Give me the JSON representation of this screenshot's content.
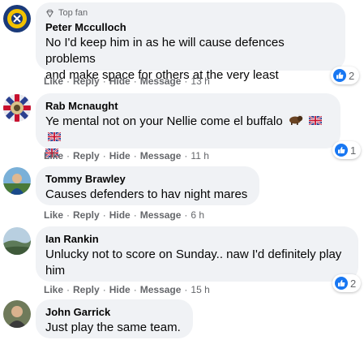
{
  "comments": [
    {
      "badge": "Top fan",
      "author": "Peter Mcculloch",
      "text_line1": "No I'd keep him in as he will cause defences problems",
      "text_line2": "and make space for others at the very least",
      "actions": {
        "like": "Like",
        "reply": "Reply",
        "hide": "Hide",
        "message": "Message",
        "time": "13 h"
      },
      "reaction_count": "2"
    },
    {
      "author": "Rab Mcnaught",
      "text": "Ye mental not on your Nellie come el buffalo",
      "emojis": [
        "bison-emoji",
        "uk-flag-emoji",
        "uk-flag-emoji",
        "uk-flag-emoji"
      ],
      "actions": {
        "like": "Like",
        "reply": "Reply",
        "hide": "Hide",
        "message": "Message",
        "time": "11 h"
      },
      "reaction_count": "1"
    },
    {
      "author": "Tommy Brawley",
      "text": "Causes defenders to hav night mares",
      "actions": {
        "like": "Like",
        "reply": "Reply",
        "hide": "Hide",
        "message": "Message",
        "time": "6 h"
      }
    },
    {
      "author": "Ian Rankin",
      "text_line1": "Unlucky not to score on Sunday.. naw I'd definitely play",
      "text_line2": "him",
      "actions": {
        "like": "Like",
        "reply": "Reply",
        "hide": "Hide",
        "message": "Message",
        "time": "15 h"
      },
      "reaction_count": "2"
    },
    {
      "author": "John Garrick",
      "text": "Just play the same team."
    }
  ],
  "colors": {
    "bubble": "#f0f2f5",
    "meta": "#65676b",
    "like_blue": "#1877f2"
  },
  "icons": {
    "top_fan": "diamond-icon",
    "reaction": "thumbs-up-icon"
  }
}
